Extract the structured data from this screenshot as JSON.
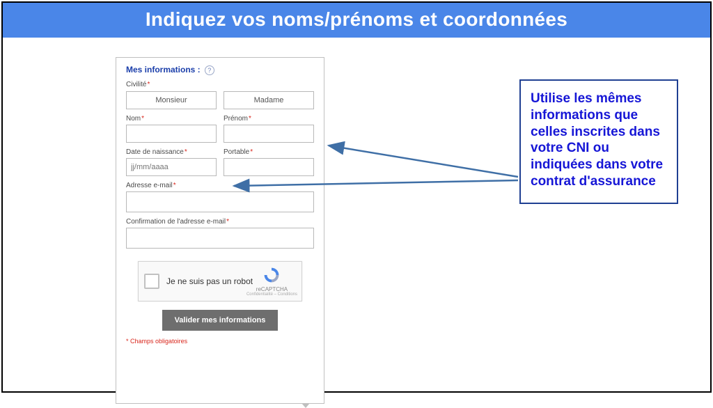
{
  "banner": {
    "title": "Indiquez vos noms/prénoms et coordonnées"
  },
  "section": {
    "title": "Mes informations :",
    "help": "?"
  },
  "fields": {
    "civility_label": "Civilité",
    "monsieur": "Monsieur",
    "madame": "Madame",
    "nom_label": "Nom",
    "prenom_label": "Prénom",
    "dob_label": "Date de naissance",
    "dob_placeholder": "jj/mm/aaaa",
    "portable_label": "Portable",
    "email_label": "Adresse e-mail",
    "email_confirm_label": "Confirmation de l'adresse e-mail"
  },
  "recaptcha": {
    "label": "Je ne suis pas un robot",
    "brand": "reCAPTCHA",
    "terms": "Confidentialité – Conditions"
  },
  "submit": {
    "label": "Valider mes informations"
  },
  "mandatory": {
    "asterisk": "*",
    "note": "Champs obligatoires"
  },
  "callout": {
    "text": "Utilise les mêmes informations que celles inscrites dans votre CNI ou indiquées dans votre contrat d'assurance"
  },
  "colors": {
    "accent": "#4a86e8",
    "required": "#d9261c",
    "link_blue": "#1616d6",
    "callout_border": "#1f3f92",
    "arrow": "#3f6fa6"
  }
}
